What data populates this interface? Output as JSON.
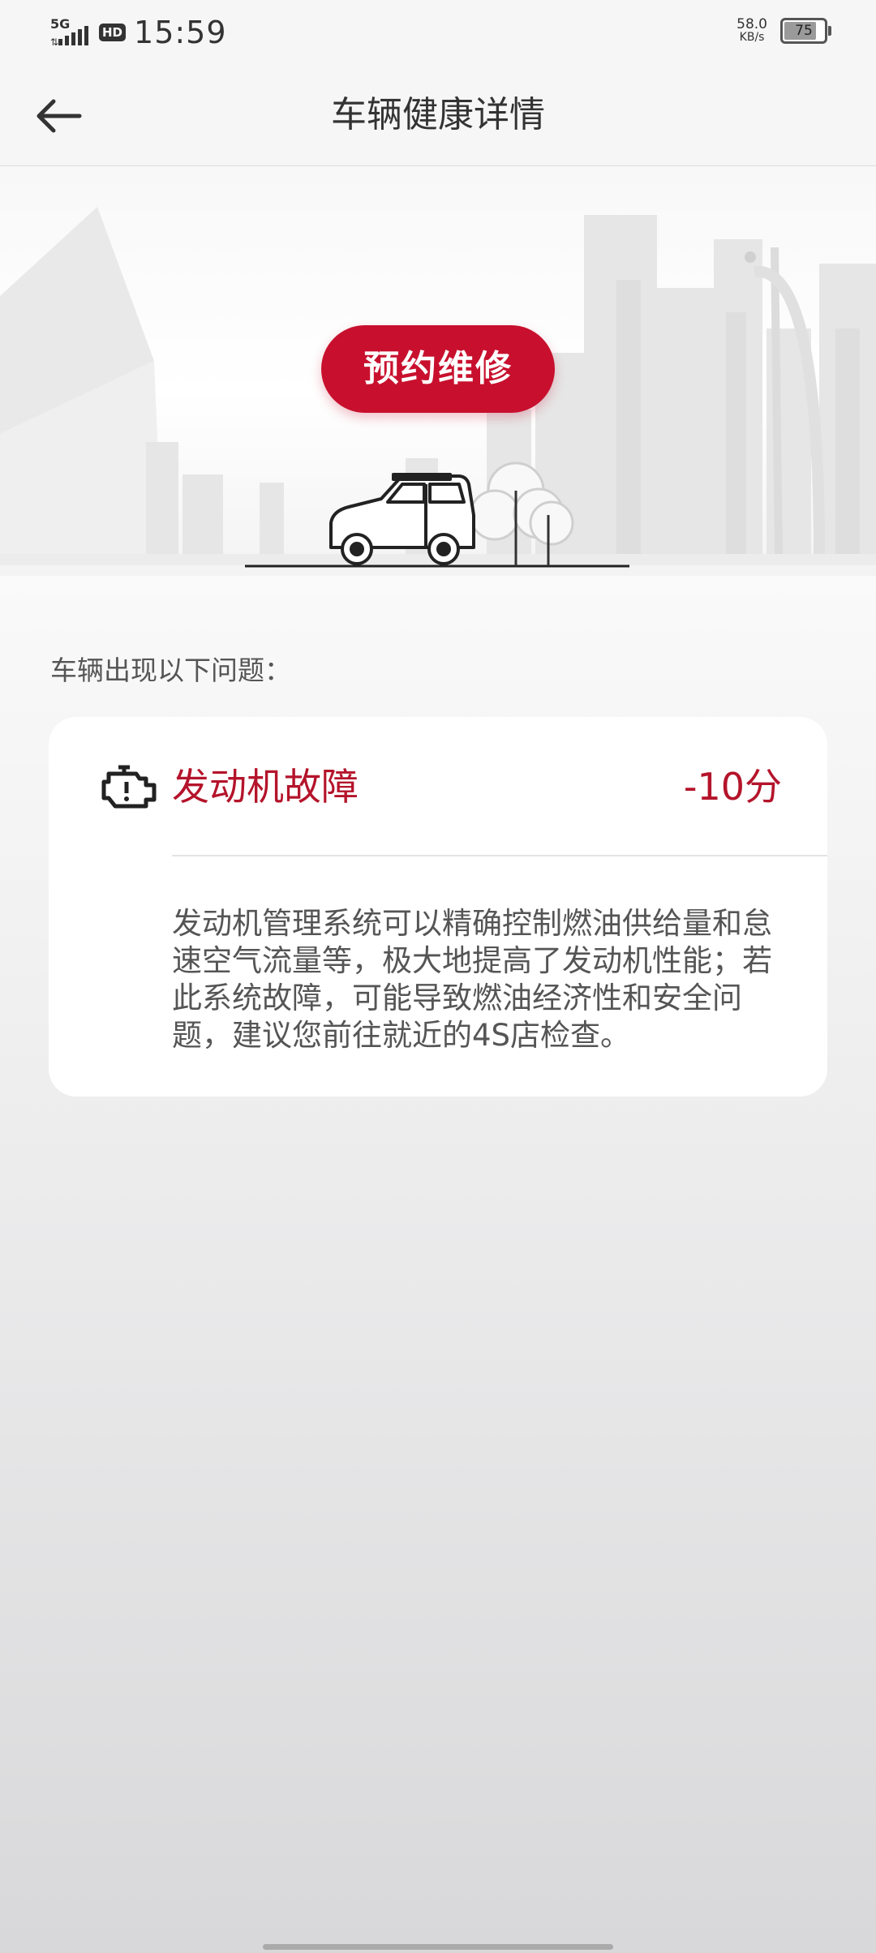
{
  "status_bar": {
    "network": "5G",
    "hd_badge": "HD",
    "time": "15:59",
    "speed_value": "58.0",
    "speed_unit": "KB/s",
    "battery": "75"
  },
  "header": {
    "title": "车辆健康详情"
  },
  "hero": {
    "button_label": "预约维修"
  },
  "issues": {
    "section_label": "车辆出现以下问题：",
    "items": [
      {
        "name": "发动机故障",
        "score": "-10分",
        "icon": "engine-icon",
        "description": "发动机管理系统可以精确控制燃油供给量和怠速空气流量等，极大地提高了发动机性能；若此系统故障，可能导致燃油经济性和安全问题，建议您前往就近的4S店检查。"
      }
    ]
  },
  "colors": {
    "accent": "#c8102e",
    "fault_text": "#b4142b"
  }
}
